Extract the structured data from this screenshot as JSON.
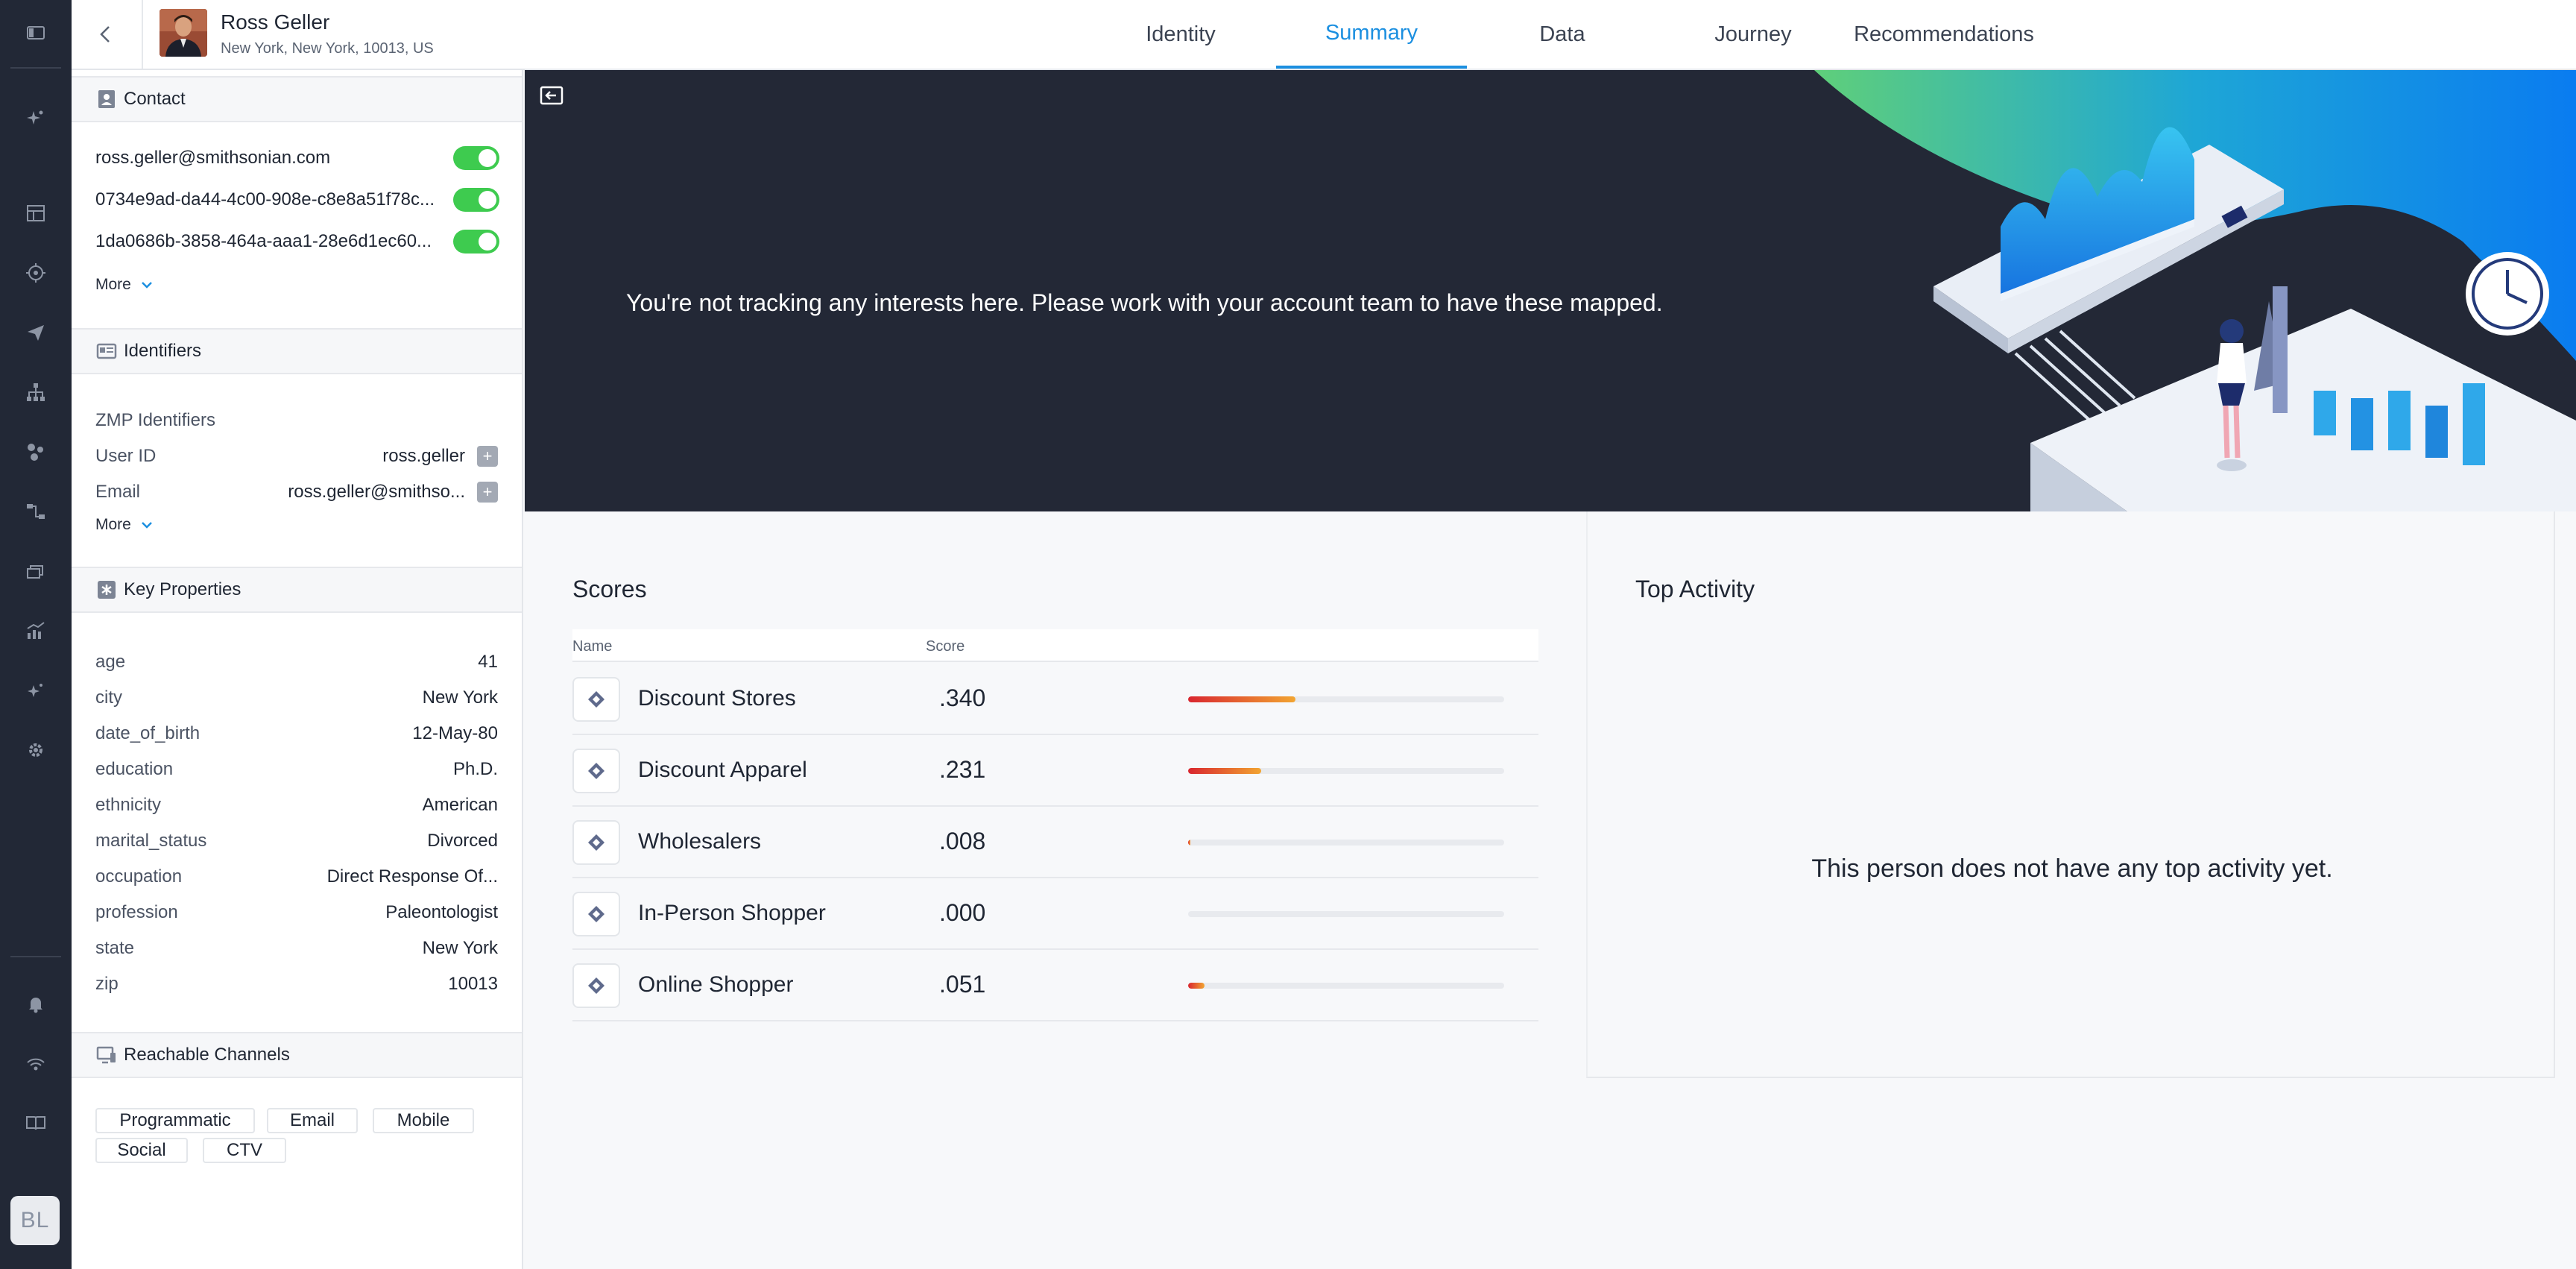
{
  "header": {
    "person_name": "Ross Geller",
    "person_location": "New York, New York, 10013, US",
    "tabs": [
      {
        "label": "Identity",
        "active": false
      },
      {
        "label": "Summary",
        "active": true
      },
      {
        "label": "Data",
        "active": false
      },
      {
        "label": "Journey",
        "active": false
      },
      {
        "label": "Recommendations",
        "active": false
      }
    ],
    "accent_color": "#1b8fe0"
  },
  "rail": {
    "user_initials": "BL",
    "icons": [
      "sidebar-toggle-icon",
      "sparkle-icon",
      "dashboard-icon",
      "target-icon",
      "send-icon",
      "hierarchy-icon",
      "people-icon",
      "flow-icon",
      "layers-icon",
      "analytics-icon",
      "magic-icon",
      "gear-icon",
      "bell-icon",
      "signal-icon",
      "book-icon"
    ]
  },
  "contact": {
    "title": "Contact",
    "items": [
      {
        "value": "ross.geller@smithsonian.com",
        "enabled": true
      },
      {
        "value": "0734e9ad-da44-4c00-908e-c8e8a51f78c...",
        "enabled": true
      },
      {
        "value": "1da0686b-3858-464a-aaa1-28e6d1ec60...",
        "enabled": true
      }
    ],
    "more_label": "More"
  },
  "identifiers": {
    "title": "Identifiers",
    "subtitle": "ZMP Identifiers",
    "rows": [
      {
        "key": "User ID",
        "value": "ross.geller"
      },
      {
        "key": "Email",
        "value": "ross.geller@smithso..."
      }
    ],
    "more_label": "More"
  },
  "key_properties": {
    "title": "Key Properties",
    "rows": [
      {
        "key": "age",
        "value": "41"
      },
      {
        "key": "city",
        "value": "New York"
      },
      {
        "key": "date_of_birth",
        "value": "12-May-80"
      },
      {
        "key": "education",
        "value": "Ph.D."
      },
      {
        "key": "ethnicity",
        "value": "American"
      },
      {
        "key": "marital_status",
        "value": "Divorced"
      },
      {
        "key": "occupation",
        "value": "Direct Response Of..."
      },
      {
        "key": "profession",
        "value": "Paleontologist"
      },
      {
        "key": "state",
        "value": "New York"
      },
      {
        "key": "zip",
        "value": "10013"
      }
    ]
  },
  "reachable_channels": {
    "title": "Reachable Channels",
    "chips": [
      "Programmatic",
      "Email",
      "Mobile",
      "Social",
      "CTV"
    ]
  },
  "banner": {
    "message": "You're not tracking any interests here. Please work with your account team to have these mapped."
  },
  "scores": {
    "title": "Scores",
    "col_name": "Name",
    "col_score": "Score",
    "rows": [
      {
        "name": "Discount Stores",
        "score_label": ".340",
        "score": 0.34
      },
      {
        "name": "Discount Apparel",
        "score_label": ".231",
        "score": 0.231
      },
      {
        "name": "Wholesalers",
        "score_label": ".008",
        "score": 0.008
      },
      {
        "name": "In-Person Shopper",
        "score_label": ".000",
        "score": 0.0
      },
      {
        "name": "Online Shopper",
        "score_label": ".051",
        "score": 0.051
      }
    ]
  },
  "top_activity": {
    "title": "Top Activity",
    "empty_message": "This person does not have any top activity yet."
  }
}
